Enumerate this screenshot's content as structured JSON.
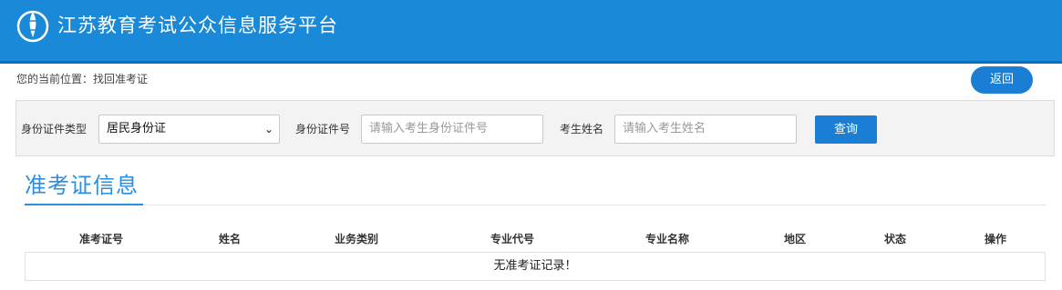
{
  "header": {
    "title": "江苏教育考试公众信息服务平台",
    "logo_icon": "exam-authority-logo-icon",
    "bg_color": "#1a8ad8"
  },
  "breadcrumb": {
    "text": "您的当前位置：找回准考证"
  },
  "back_button": {
    "label": "返回"
  },
  "search": {
    "id_type_label": "身份证件类型",
    "id_type_value": "居民身份证",
    "id_number_label": "身份证件号",
    "id_number_placeholder": "请输入考生身份证件号",
    "name_label": "考生姓名",
    "name_placeholder": "请输入考生姓名",
    "query_label": "查询"
  },
  "section": {
    "title": "准考证信息"
  },
  "table": {
    "columns": [
      "准考证号",
      "姓名",
      "业务类别",
      "专业代号",
      "专业名称",
      "地区",
      "状态",
      "操作"
    ],
    "empty_message": "无准考证记录！"
  },
  "colors": {
    "accent": "#1a7fd4",
    "title_blue": "#2b8ee0"
  }
}
